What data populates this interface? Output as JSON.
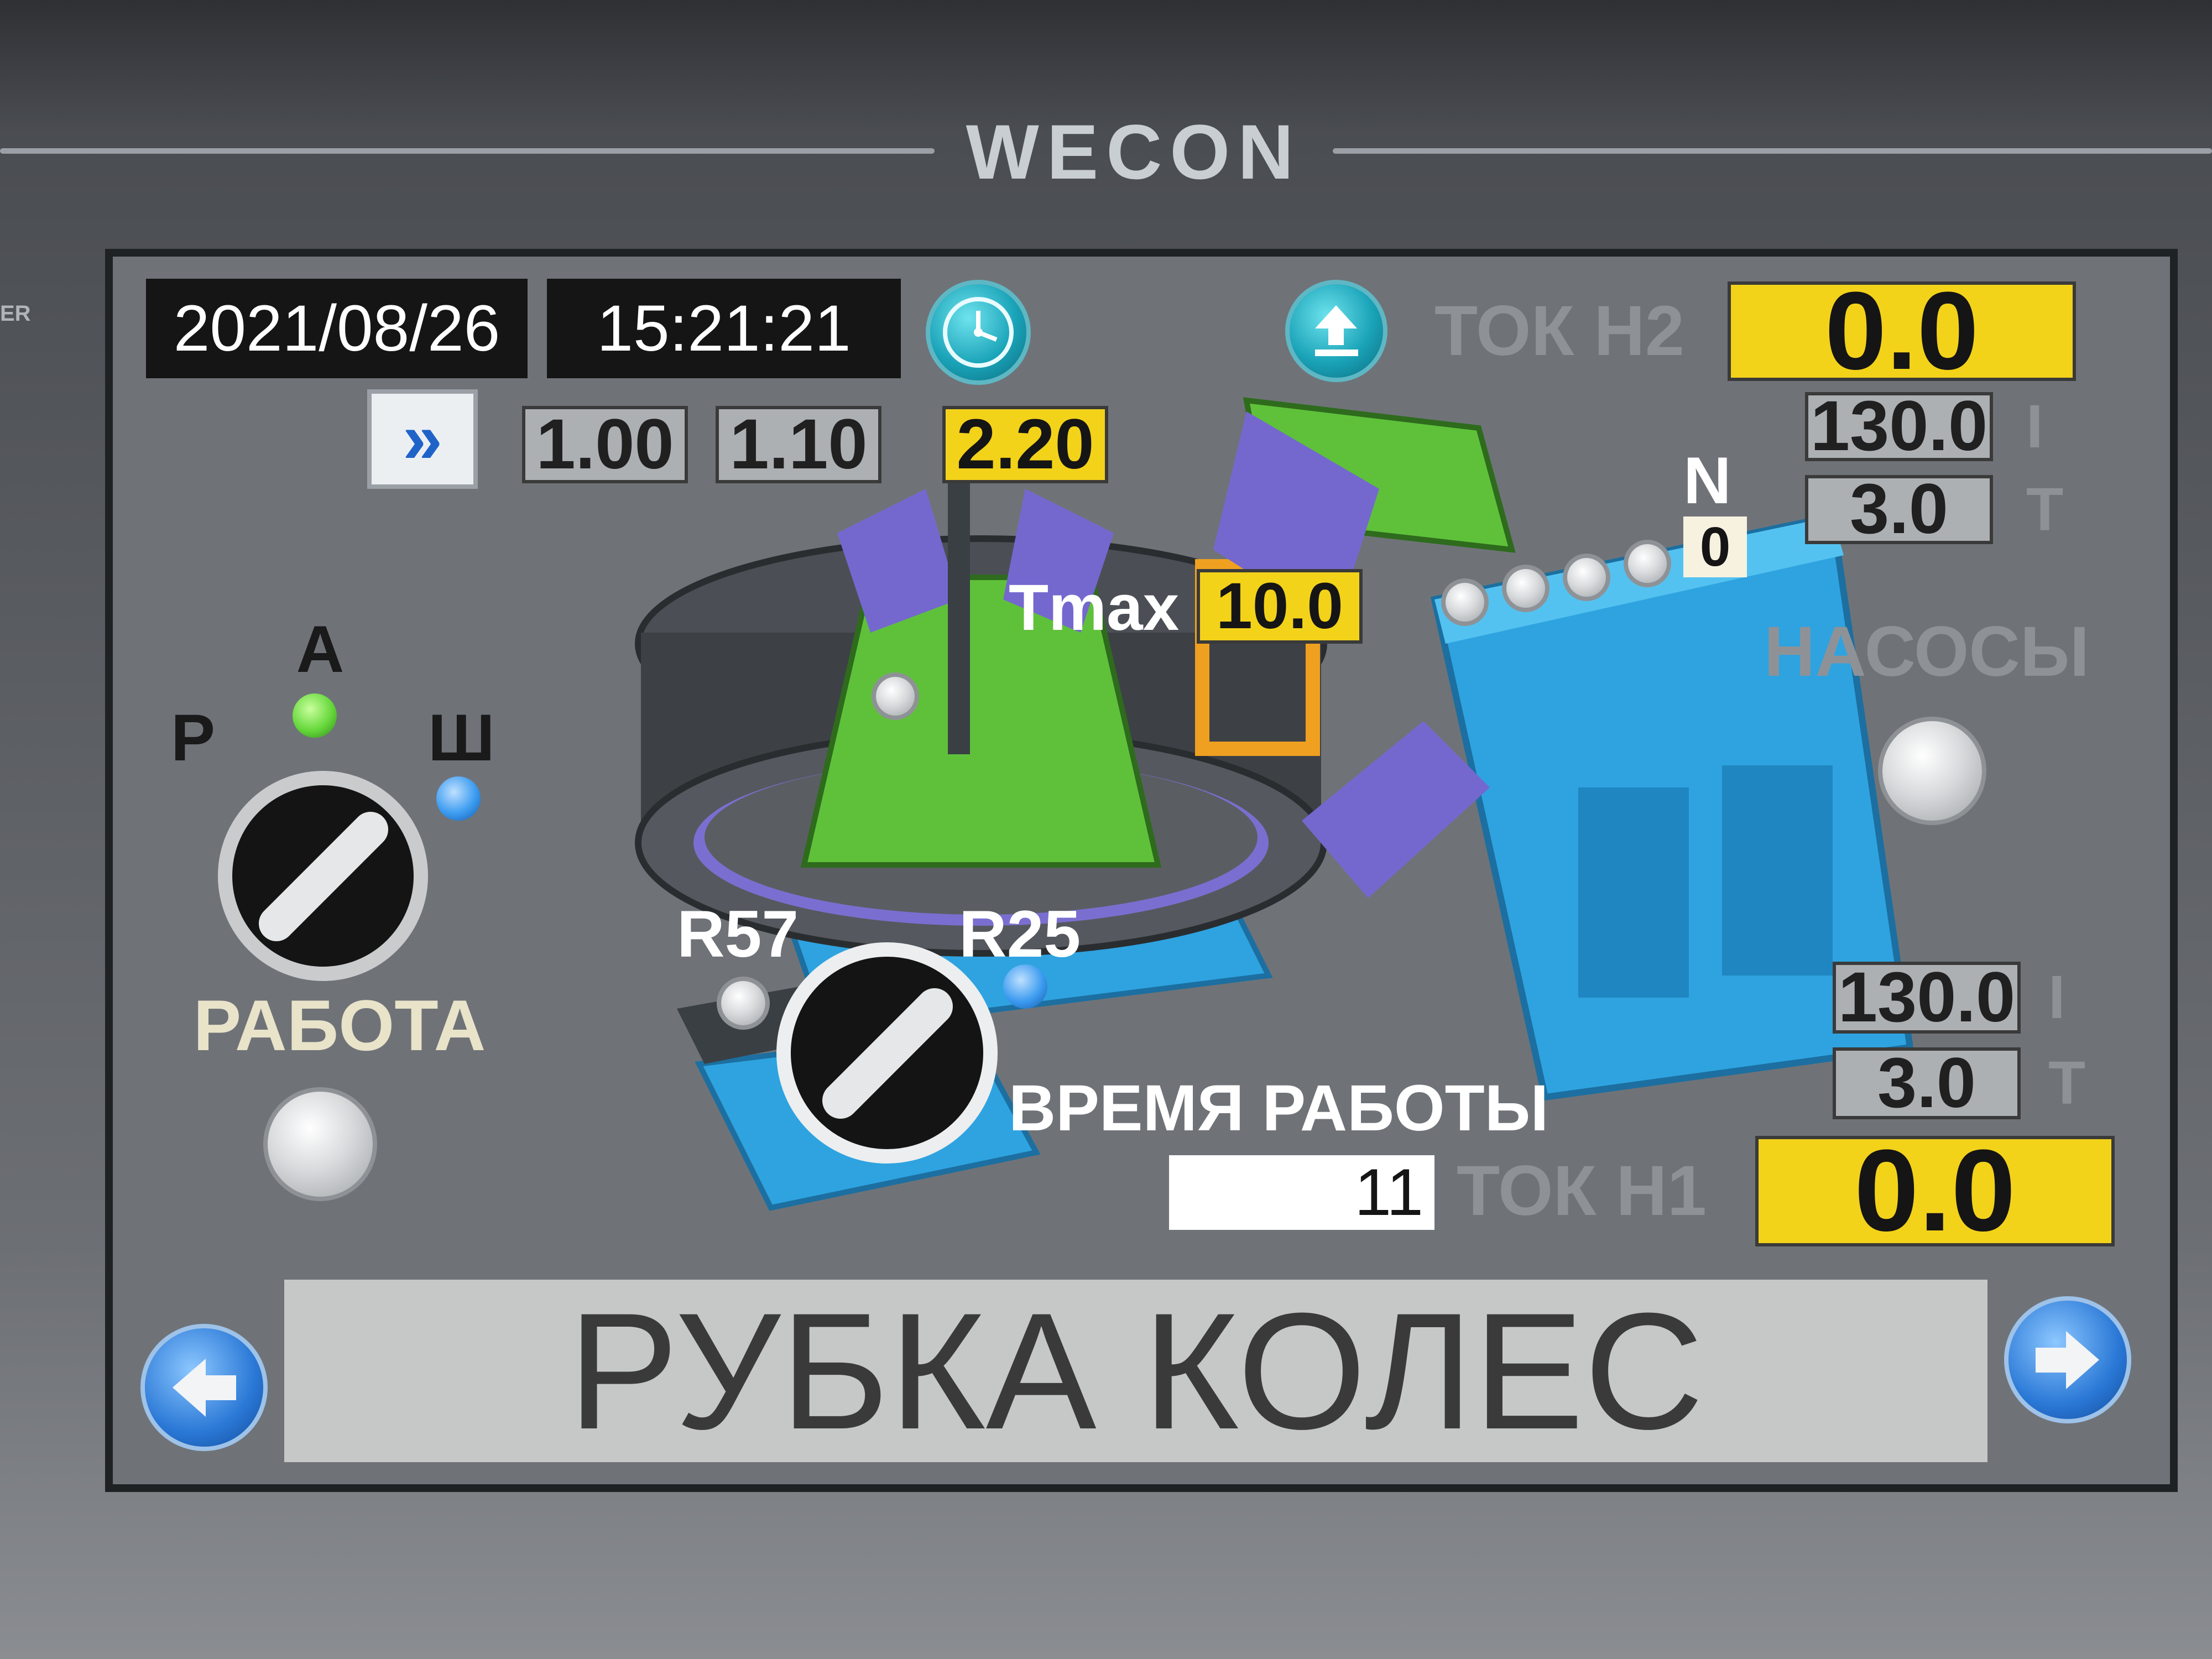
{
  "bezel": {
    "brand": "WECON",
    "side_tag": "ER"
  },
  "header": {
    "date": "2021/08/26",
    "time": "15:21:21",
    "clock_icon": "clock-icon",
    "upload_icon": "upload-icon"
  },
  "presets": {
    "next_label": "»",
    "values": [
      "1.00",
      "1.10",
      "2.20"
    ],
    "active_index": 2
  },
  "tok_h2": {
    "label": "ТОК Н2",
    "value": "0.0",
    "i_value": "130.0",
    "i_unit": "I",
    "t_value": "3.0",
    "t_unit": "T"
  },
  "tok_h1": {
    "label": "ТОК Н1",
    "value": "0.0",
    "i_value": "130.0",
    "i_unit": "I",
    "t_value": "3.0",
    "t_unit": "T"
  },
  "position": {
    "n_label": "N",
    "n_value": "0"
  },
  "tmax": {
    "label": "Tmax",
    "value": "10.0"
  },
  "pumps": {
    "label": "НАСОСЫ"
  },
  "mode": {
    "label_a": "А",
    "label_r": "Р",
    "label_sh": "Ш",
    "caption": "РАБОТА"
  },
  "rotation": {
    "left_label": "R57",
    "right_label": "R25"
  },
  "runtime": {
    "label": "ВРЕМЯ РАБОТЫ",
    "value": "11"
  },
  "footer": {
    "title": "РУБКА КОЛЕС",
    "prev_icon": "arrow-left-icon",
    "next_icon": "arrow-right-icon"
  },
  "colors": {
    "yellow": "#f3d21a",
    "teal": "#1aa3b8",
    "machine_blue": "#2ea3e0",
    "machine_green": "#5fc13a",
    "indicator_green": "#67d83c",
    "indicator_blue": "#3d9cf0"
  }
}
